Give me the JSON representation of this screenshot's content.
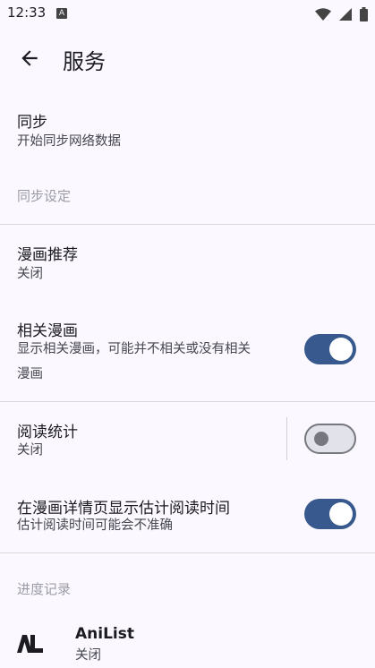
{
  "status": {
    "time": "12:33",
    "notif_letter": "A"
  },
  "header": {
    "title": "服务"
  },
  "items": {
    "sync": {
      "title": "同步",
      "summary": "开始同步网络数据"
    },
    "sync_settings_header": "同步设定",
    "recommend": {
      "title": "漫画推荐",
      "summary": "关闭"
    },
    "related": {
      "title": "相关漫画",
      "summary_line1": "显示相关漫画，可能并不相关或没有相关",
      "summary_line2": "漫画",
      "enabled": true
    },
    "stats": {
      "title": "阅读统计",
      "summary": "关闭",
      "enabled": false
    },
    "read_time": {
      "title": "在漫画详情页显示估计阅读时间",
      "summary": "估计阅读时间可能会不准确",
      "enabled": true
    },
    "progress_header": "进度记录",
    "anilist": {
      "title": "AniList",
      "summary": "关闭",
      "logo_icon": "anilist-logo-icon"
    }
  },
  "colors": {
    "accent": "#37598d",
    "background": "#fbf8ff"
  }
}
